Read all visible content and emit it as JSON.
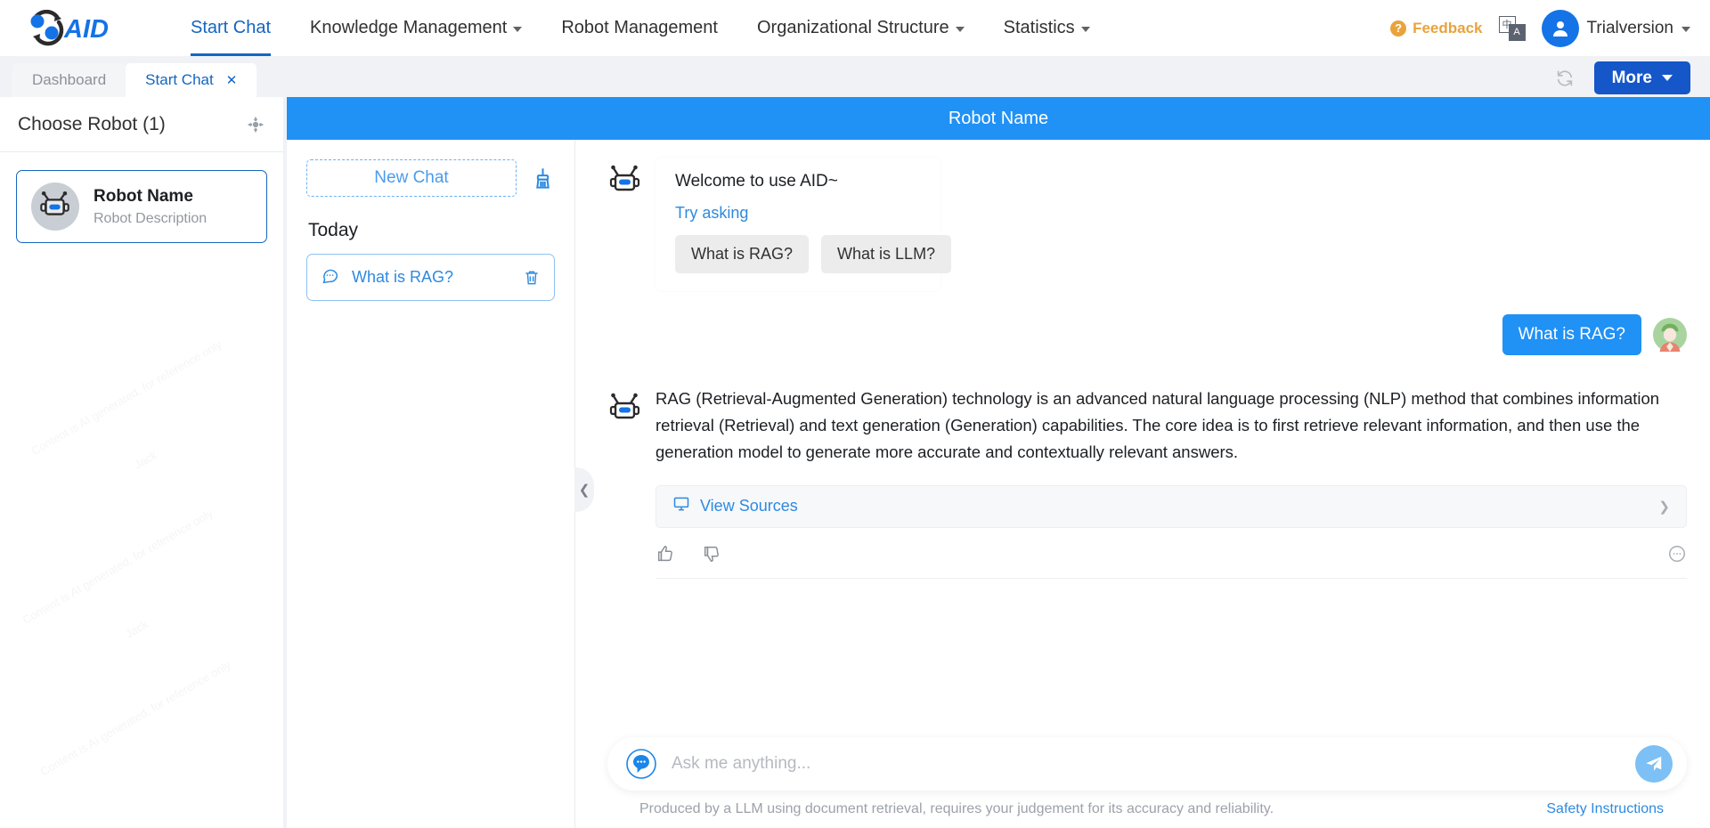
{
  "nav": {
    "logo_text": "AID",
    "items": [
      {
        "label": "Start Chat",
        "has_caret": false,
        "active": true
      },
      {
        "label": "Knowledge Management",
        "has_caret": true,
        "active": false
      },
      {
        "label": "Robot Management",
        "has_caret": false,
        "active": false
      },
      {
        "label": "Organizational Structure",
        "has_caret": true,
        "active": false
      },
      {
        "label": "Statistics",
        "has_caret": true,
        "active": false
      }
    ],
    "feedback_label": "Feedback",
    "feedback_badge": "?",
    "lang_primary": "中",
    "lang_secondary": "A",
    "user_label": "Trialversion"
  },
  "tabbar": {
    "tabs": [
      {
        "label": "Dashboard",
        "active": false,
        "closable": false
      },
      {
        "label": "Start Chat",
        "active": true,
        "closable": true
      }
    ],
    "close_glyph": "✕",
    "more_label": "More"
  },
  "robot_panel": {
    "title": "Choose Robot (1)",
    "card": {
      "name": "Robot Name",
      "description": "Robot Description"
    },
    "watermark_lines": [
      "Content is AI generated, for reference only",
      "Jack"
    ]
  },
  "chat": {
    "header_title": "Robot Name",
    "history": {
      "new_chat_label": "New Chat",
      "group_label": "Today",
      "items": [
        {
          "label": "What is RAG?",
          "selected": true
        }
      ]
    },
    "welcome": {
      "greeting": "Welcome to use AID~",
      "try_label": "Try asking",
      "suggestions": [
        "What is RAG?",
        "What is LLM?"
      ]
    },
    "messages": [
      {
        "role": "user",
        "text": "What is RAG?"
      },
      {
        "role": "assistant",
        "text": "RAG (Retrieval-Augmented Generation) technology is an advanced natural language processing (NLP) method that combines information retrieval (Retrieval) and text generation (Generation) capabilities. The core idea is to first retrieve relevant information, and then use the generation model to generate more accurate and contextually relevant answers.",
        "sources_label": "View Sources"
      }
    ],
    "composer": {
      "placeholder": "Ask me anything...",
      "value": ""
    },
    "footer": {
      "note": "Produced by a LLM using document retrieval, requires your judgement for its accuracy and reliability.",
      "safety_link": "Safety Instructions"
    }
  },
  "colors": {
    "brand_blue": "#1565c0",
    "accent_blue": "#2091f5",
    "button_blue": "#1556c9",
    "feedback_orange": "#e8a33d",
    "send_blue": "#7cc0f5"
  }
}
